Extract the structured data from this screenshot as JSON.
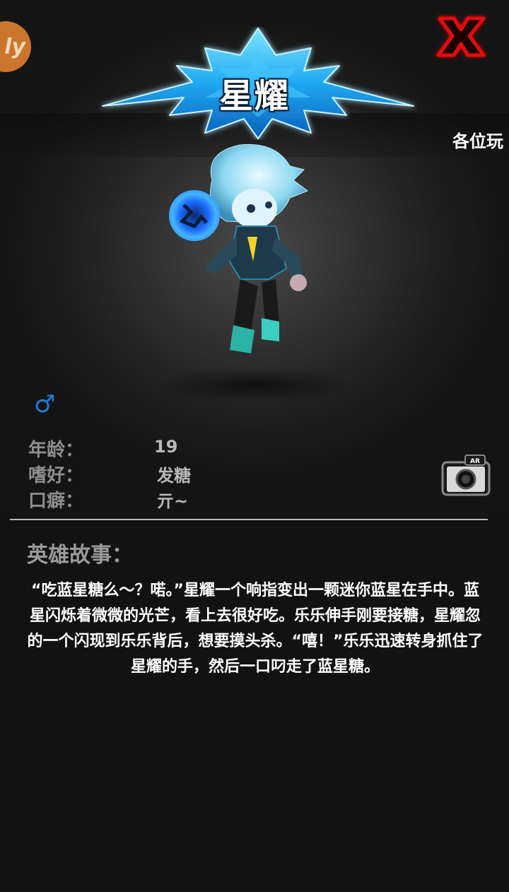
{
  "header": {
    "title": "星耀",
    "marquee_text": "各位玩",
    "badge_text": "ly",
    "close_icon": "close-x-icon"
  },
  "hero": {
    "gender_symbol": "♂",
    "attributes": [
      {
        "label": "年龄：",
        "value": "19"
      },
      {
        "label": "嗜好：",
        "value": "发糖"
      },
      {
        "label": "口癖：",
        "value": "亓~"
      }
    ],
    "camera_label": "AR"
  },
  "story": {
    "heading": "英雄故事：",
    "text": "“吃蓝星糖么～？喏。”星耀一个响指变出一颗迷你蓝星在手中。蓝星闪烁着微微的光芒，看上去很好吃。乐乐伸手刚要接糖，星耀忽的一个闪现到乐乐背后，想要摸头杀。“嘻！”乐乐迅速转身抓住了星耀的手，然后一口叼走了蓝星糖。"
  },
  "colors": {
    "accent_blue": "#1e7fd8",
    "close_red": "#e01010",
    "badge_orange": "#c9762c"
  }
}
